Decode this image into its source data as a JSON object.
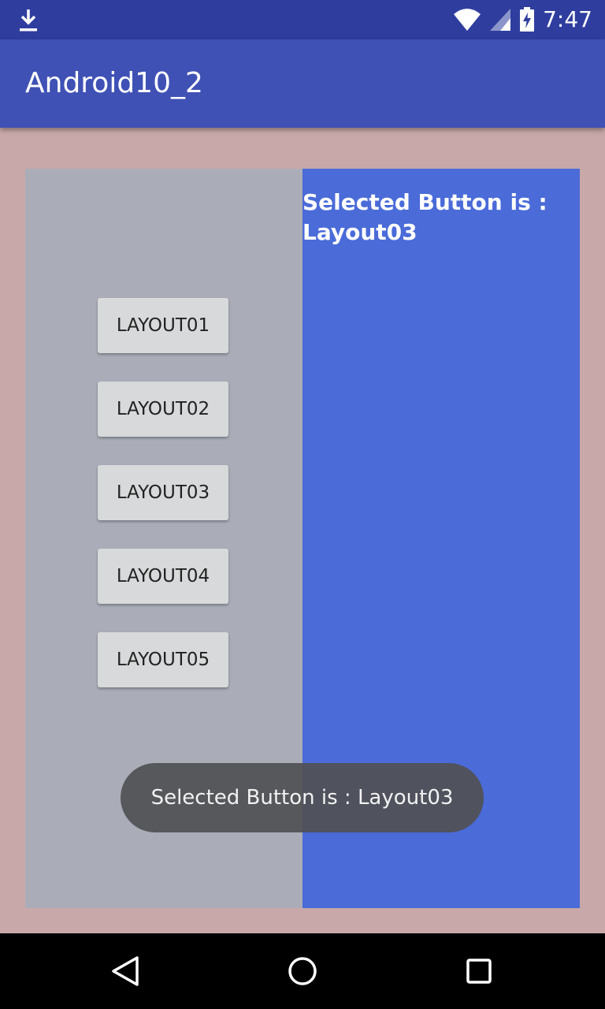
{
  "status_bar": {
    "time": "7:47",
    "icons": [
      "download-icon",
      "wifi-icon",
      "signal-icon",
      "battery-charging-icon"
    ]
  },
  "app_bar": {
    "title": "Android10_2"
  },
  "right_panel": {
    "selected_line1": "Selected Button is :",
    "selected_line2": "Layout03"
  },
  "buttons": [
    {
      "label": "LAYOUT01"
    },
    {
      "label": "LAYOUT02"
    },
    {
      "label": "LAYOUT03"
    },
    {
      "label": "LAYOUT04"
    },
    {
      "label": "LAYOUT05"
    }
  ],
  "toast": {
    "text": "Selected Button is : Layout03"
  },
  "nav_bar": {
    "icons": [
      "back-icon",
      "home-icon",
      "recents-icon"
    ]
  },
  "colors": {
    "status_bar": "#2f3e9e",
    "app_bar": "#3f51b5",
    "background": "#c8a8a8",
    "left_panel": "#aaadb8",
    "right_panel": "#4a6bd8",
    "button": "#d7d9da",
    "toast": "#505052"
  }
}
